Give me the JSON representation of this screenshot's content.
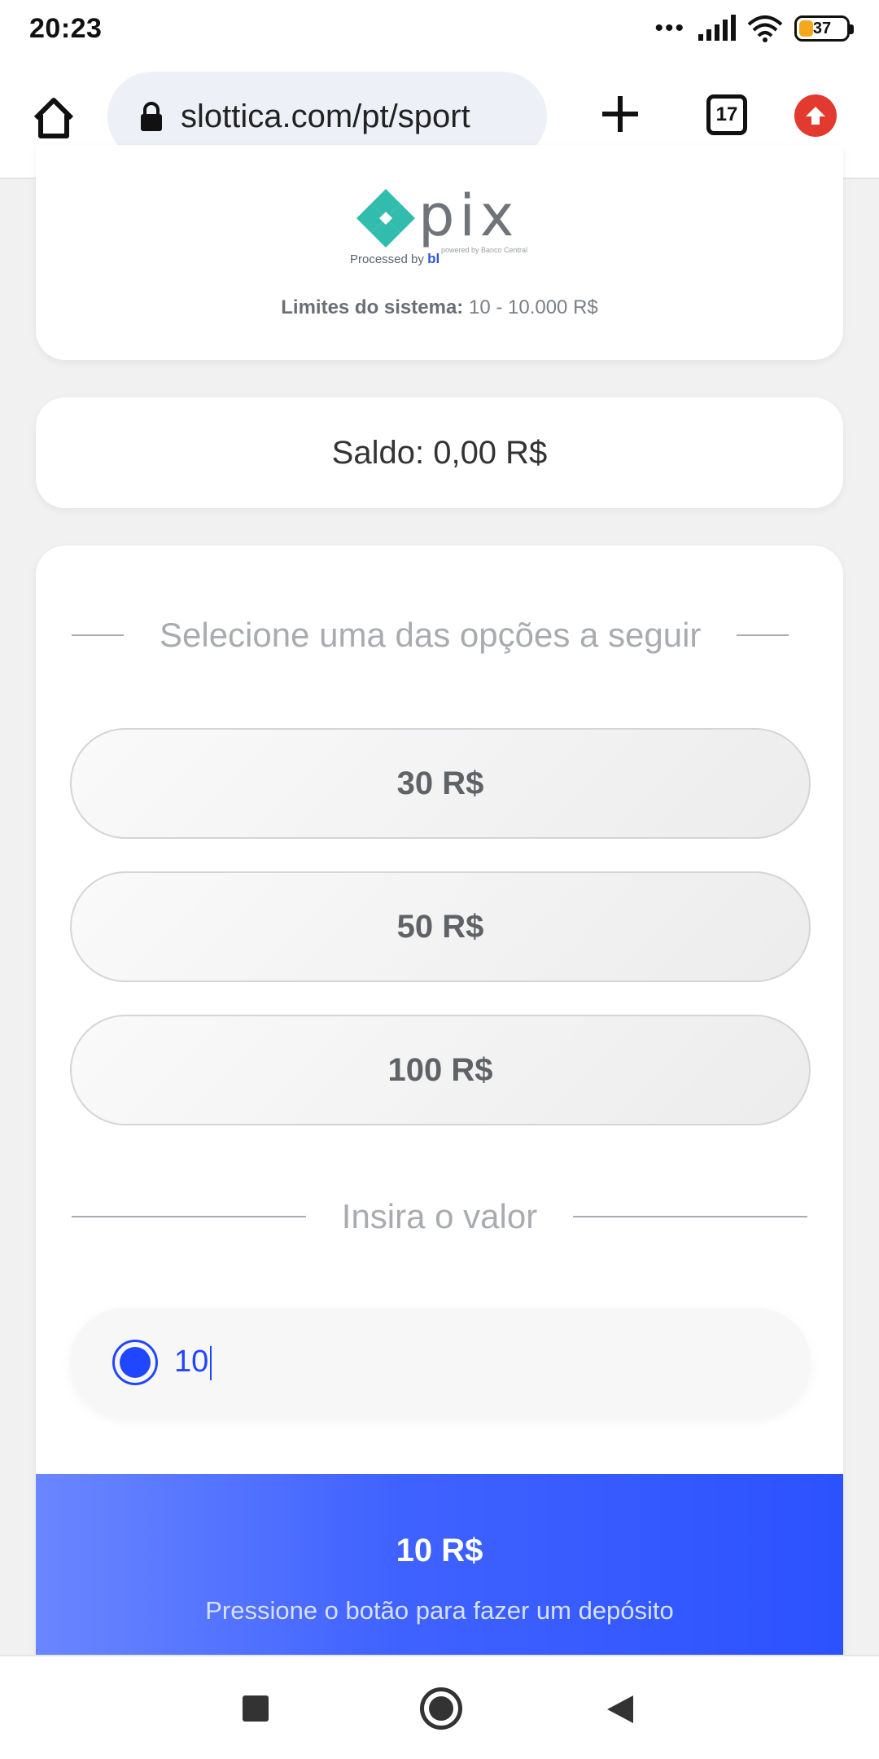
{
  "status_bar": {
    "time": "20:23",
    "dots": "•••",
    "battery_level": "37",
    "battery_color": "#f5a81c"
  },
  "browser": {
    "url": "slottica.com/pt/sport",
    "tabs_count": "17",
    "icons": {
      "home": "home-icon",
      "lock": "lock-icon",
      "new_tab": "plus-icon",
      "tabs": "tabs-icon",
      "update": "update-arrow-icon"
    }
  },
  "payment": {
    "logo_text": "pix",
    "logo_subtext": "powered by Banco Central",
    "processed_by_label": "Processed by",
    "processed_by_brand": "bl",
    "limits_label": "Limites do sistema:",
    "limits_value": "10 - 10.000 R$"
  },
  "balance": {
    "text": "Saldo: 0,00 R$"
  },
  "options": {
    "section_title": "Selecione uma das opções a seguir",
    "items": [
      {
        "label": "30 R$"
      },
      {
        "label": "50 R$"
      },
      {
        "label": "100 R$"
      }
    ]
  },
  "amount": {
    "section_title": "Insira o valor",
    "value": "10"
  },
  "deposit": {
    "amount": "10 R$",
    "hint": "Pressione o botão para fazer um depósito",
    "accent_color": "#3f62ff",
    "button_color": "#25c16f"
  },
  "nav": {
    "recent": "recent-apps-icon",
    "home": "home-circle-icon",
    "back": "back-triangle-icon"
  }
}
